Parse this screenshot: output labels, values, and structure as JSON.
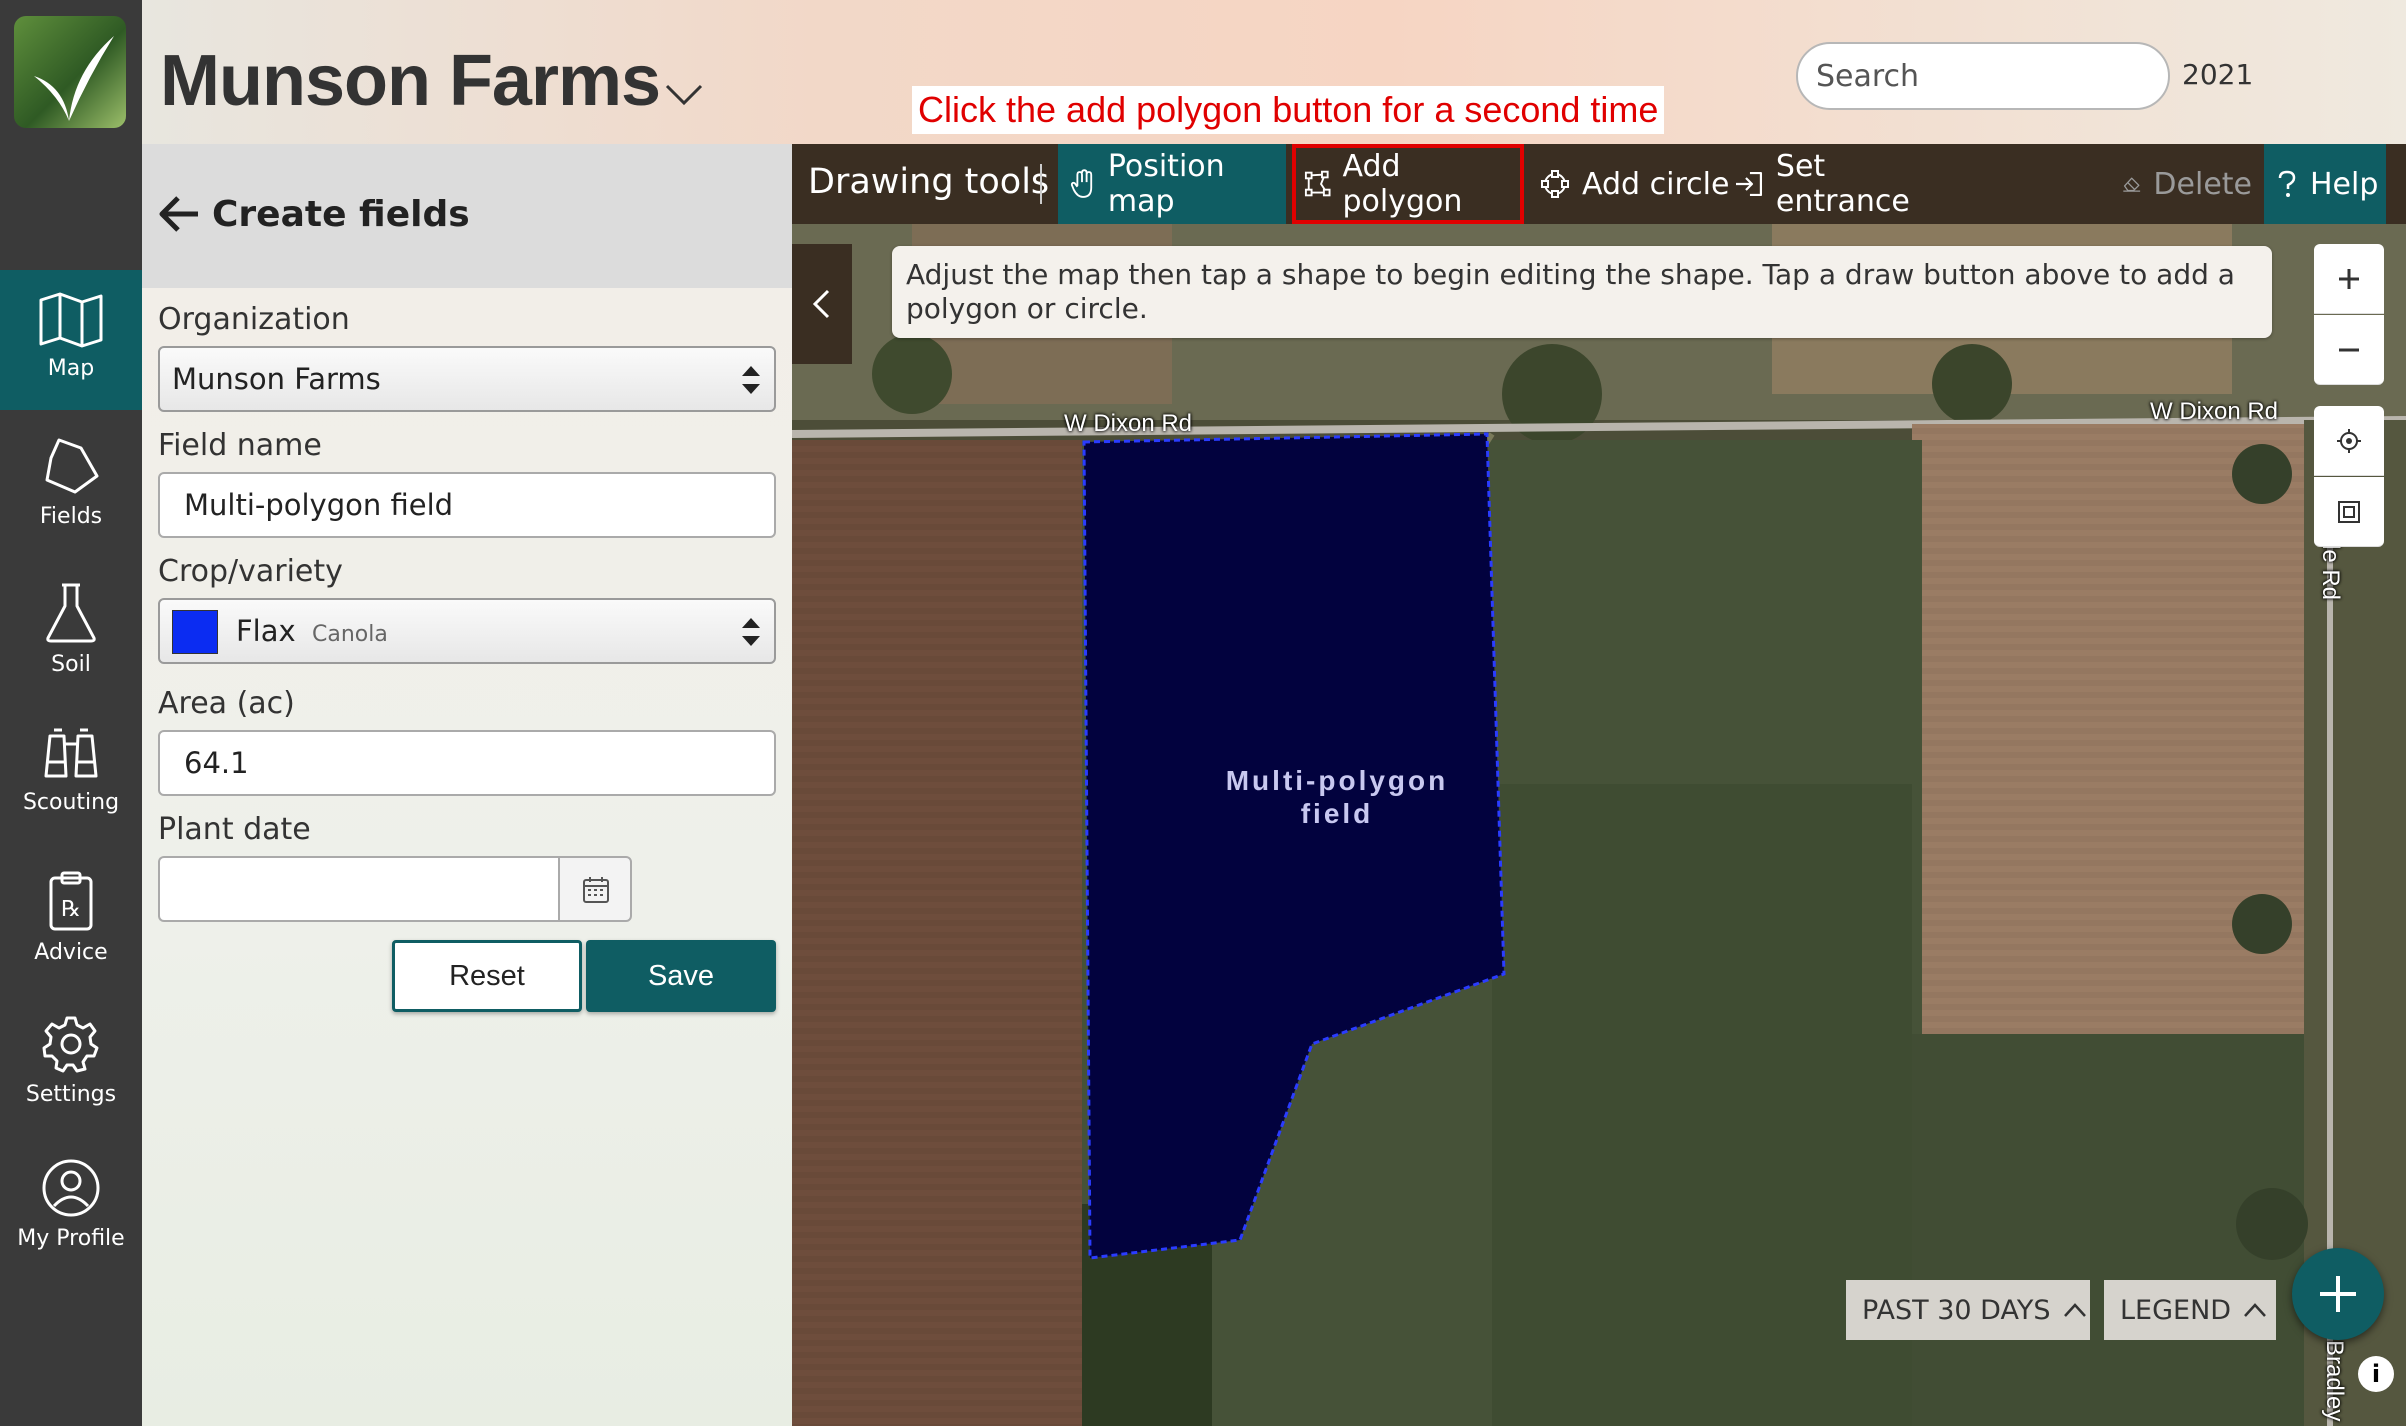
{
  "app": {
    "farm_name": "Munson Farms"
  },
  "instruction_banner": "Click the add polygon button for a second time",
  "header": {
    "search_placeholder": "Search",
    "year": "2021"
  },
  "rail": {
    "items": [
      {
        "label": "Map",
        "icon": "map-icon",
        "active": true
      },
      {
        "label": "Fields",
        "icon": "fields-icon"
      },
      {
        "label": "Soil",
        "icon": "flask-icon"
      },
      {
        "label": "Scouting",
        "icon": "binoculars-icon"
      },
      {
        "label": "Advice",
        "icon": "prescription-icon"
      },
      {
        "label": "Settings",
        "icon": "gear-icon"
      },
      {
        "label": "My Profile",
        "icon": "profile-icon"
      }
    ]
  },
  "panel": {
    "title": "Create fields",
    "organization_label": "Organization",
    "organization_value": "Munson Farms",
    "field_name_label": "Field name",
    "field_name_value": "Multi-polygon field",
    "crop_label": "Crop/variety",
    "crop_name": "Flax",
    "crop_variety": "Canola",
    "crop_color": "#0b2cf2",
    "area_label": "Area (ac)",
    "area_value": "64.1",
    "plant_date_label": "Plant date",
    "plant_date_value": "",
    "reset_label": "Reset",
    "save_label": "Save"
  },
  "toolbar": {
    "title": "Drawing tools",
    "position_map": "Position map",
    "add_polygon": "Add polygon",
    "add_circle": "Add circle",
    "set_entrance": "Set entrance",
    "delete": "Delete",
    "help": "Help"
  },
  "map": {
    "hint": "Adjust the map then tap a shape to begin editing the shape. Tap a draw button above to add a polygon or circle.",
    "road_left": "W Dixon Rd",
    "road_right": "W Dixon Rd",
    "road_vertical": "le Rd",
    "road_bottom": "Bradley",
    "field_label": "Multi-polygon field",
    "past_button": "PAST 30 DAYS",
    "legend_button": "LEGEND",
    "zoom_in": "+",
    "zoom_out": "−",
    "info": "i"
  },
  "colors": {
    "accent": "#0f5d63",
    "toolbar_bg": "#3a2e22",
    "field_fill": "#02023e",
    "highlight": "#e00000"
  }
}
